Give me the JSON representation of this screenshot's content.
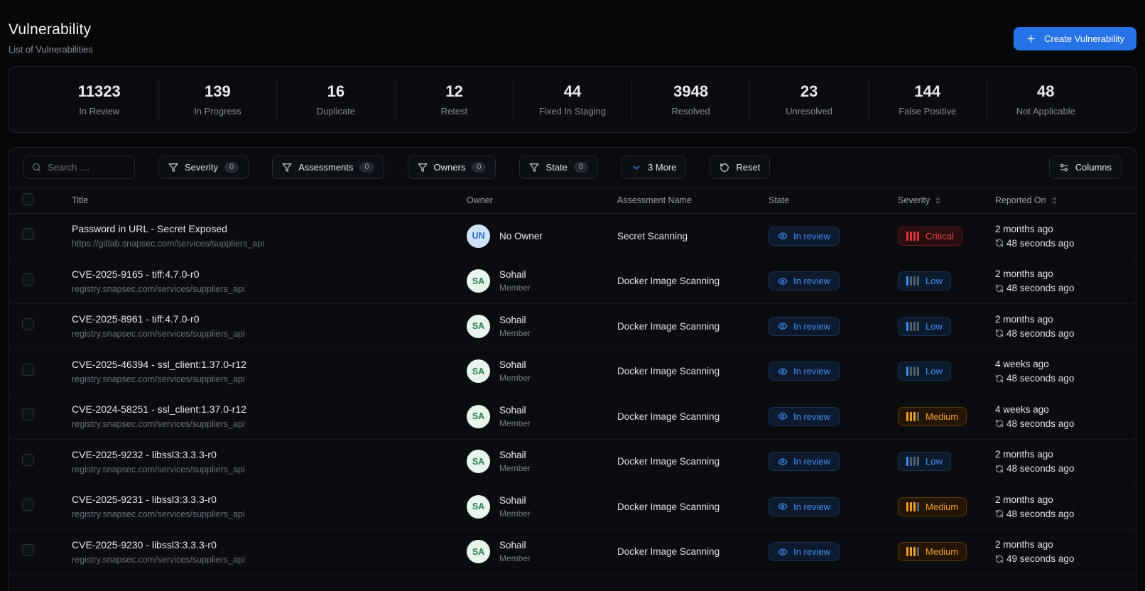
{
  "page": {
    "title": "Vulnerability",
    "subtitle": "List of Vulnerabilities",
    "create_button_label": "Create Vulnerability"
  },
  "stats": [
    {
      "value": "11323",
      "label": "In Review"
    },
    {
      "value": "139",
      "label": "In Progress"
    },
    {
      "value": "16",
      "label": "Duplicate"
    },
    {
      "value": "12",
      "label": "Retest"
    },
    {
      "value": "44",
      "label": "Fixed In Staging"
    },
    {
      "value": "3948",
      "label": "Resolved"
    },
    {
      "value": "23",
      "label": "Unresolved"
    },
    {
      "value": "144",
      "label": "False Positive"
    },
    {
      "value": "48",
      "label": "Not Applicable"
    }
  ],
  "filters": {
    "search_placeholder": "Search ....",
    "filter_buttons": [
      {
        "label": "Severity",
        "count": "0"
      },
      {
        "label": "Assessments",
        "count": "0"
      },
      {
        "label": "Owners",
        "count": "0"
      },
      {
        "label": "State",
        "count": "0"
      }
    ],
    "more_label": "3 More",
    "reset_label": "Reset",
    "columns_label": "Columns"
  },
  "table": {
    "headers": {
      "title": "Title",
      "owner": "Owner",
      "assessment": "Assessment Name",
      "state": "State",
      "severity": "Severity",
      "reported": "Reported On"
    },
    "severity_bars": {
      "Critical": 4,
      "Medium": 3,
      "Low": 1
    },
    "rows": [
      {
        "title": "Password in URL - Secret Exposed",
        "url": "https://gitlab.snapsec.com/services/suppliers_api",
        "avatar": "UN",
        "avatar_style": "un",
        "owner": "No Owner",
        "owner_role": "",
        "assessment": "Secret Scanning",
        "state": "In review",
        "severity": "Critical",
        "reported": "2 months ago",
        "elapsed": "48 seconds ago"
      },
      {
        "title": "CVE-2025-9165 - tiff:4.7.0-r0",
        "url": "registry.snapsec.com/services/suppliers_api",
        "avatar": "SA",
        "avatar_style": "sa",
        "owner": "Sohail",
        "owner_role": "Member",
        "assessment": "Docker Image Scanning",
        "state": "In review",
        "severity": "Low",
        "reported": "2 months ago",
        "elapsed": "48 seconds ago"
      },
      {
        "title": "CVE-2025-8961 - tiff:4.7.0-r0",
        "url": "registry.snapsec.com/services/suppliers_api",
        "avatar": "SA",
        "avatar_style": "sa",
        "owner": "Sohail",
        "owner_role": "Member",
        "assessment": "Docker Image Scanning",
        "state": "In review",
        "severity": "Low",
        "reported": "2 months ago",
        "elapsed": "48 seconds ago"
      },
      {
        "title": "CVE-2025-46394 - ssl_client:1.37.0-r12",
        "url": "registry.snapsec.com/services/suppliers_api",
        "avatar": "SA",
        "avatar_style": "sa",
        "owner": "Sohail",
        "owner_role": "Member",
        "assessment": "Docker Image Scanning",
        "state": "In review",
        "severity": "Low",
        "reported": "4 weeks ago",
        "elapsed": "48 seconds ago"
      },
      {
        "title": "CVE-2024-58251 - ssl_client:1.37.0-r12",
        "url": "registry.snapsec.com/services/suppliers_api",
        "avatar": "SA",
        "avatar_style": "sa",
        "owner": "Sohail",
        "owner_role": "Member",
        "assessment": "Docker Image Scanning",
        "state": "In review",
        "severity": "Medium",
        "reported": "4 weeks ago",
        "elapsed": "48 seconds ago"
      },
      {
        "title": "CVE-2025-9232 - libssl3:3.3.3-r0",
        "url": "registry.snapsec.com/services/suppliers_api",
        "avatar": "SA",
        "avatar_style": "sa",
        "owner": "Sohail",
        "owner_role": "Member",
        "assessment": "Docker Image Scanning",
        "state": "In review",
        "severity": "Low",
        "reported": "2 months ago",
        "elapsed": "48 seconds ago"
      },
      {
        "title": "CVE-2025-9231 - libssl3:3.3.3-r0",
        "url": "registry.snapsec.com/services/suppliers_api",
        "avatar": "SA",
        "avatar_style": "sa",
        "owner": "Sohail",
        "owner_role": "Member",
        "assessment": "Docker Image Scanning",
        "state": "In review",
        "severity": "Medium",
        "reported": "2 months ago",
        "elapsed": "48 seconds ago"
      },
      {
        "title": "CVE-2025-9230 - libssl3:3.3.3-r0",
        "url": "registry.snapsec.com/services/suppliers_api",
        "avatar": "SA",
        "avatar_style": "sa",
        "owner": "Sohail",
        "owner_role": "Member",
        "assessment": "Docker Image Scanning",
        "state": "In review",
        "severity": "Medium",
        "reported": "2 months ago",
        "elapsed": "49 seconds ago"
      }
    ]
  },
  "colors": {
    "accent_blue": "#2673e8",
    "state_in_review": "#4090f7",
    "severity_critical": "#ee4444",
    "severity_medium": "#f0a028",
    "severity_low": "#4090f7"
  }
}
